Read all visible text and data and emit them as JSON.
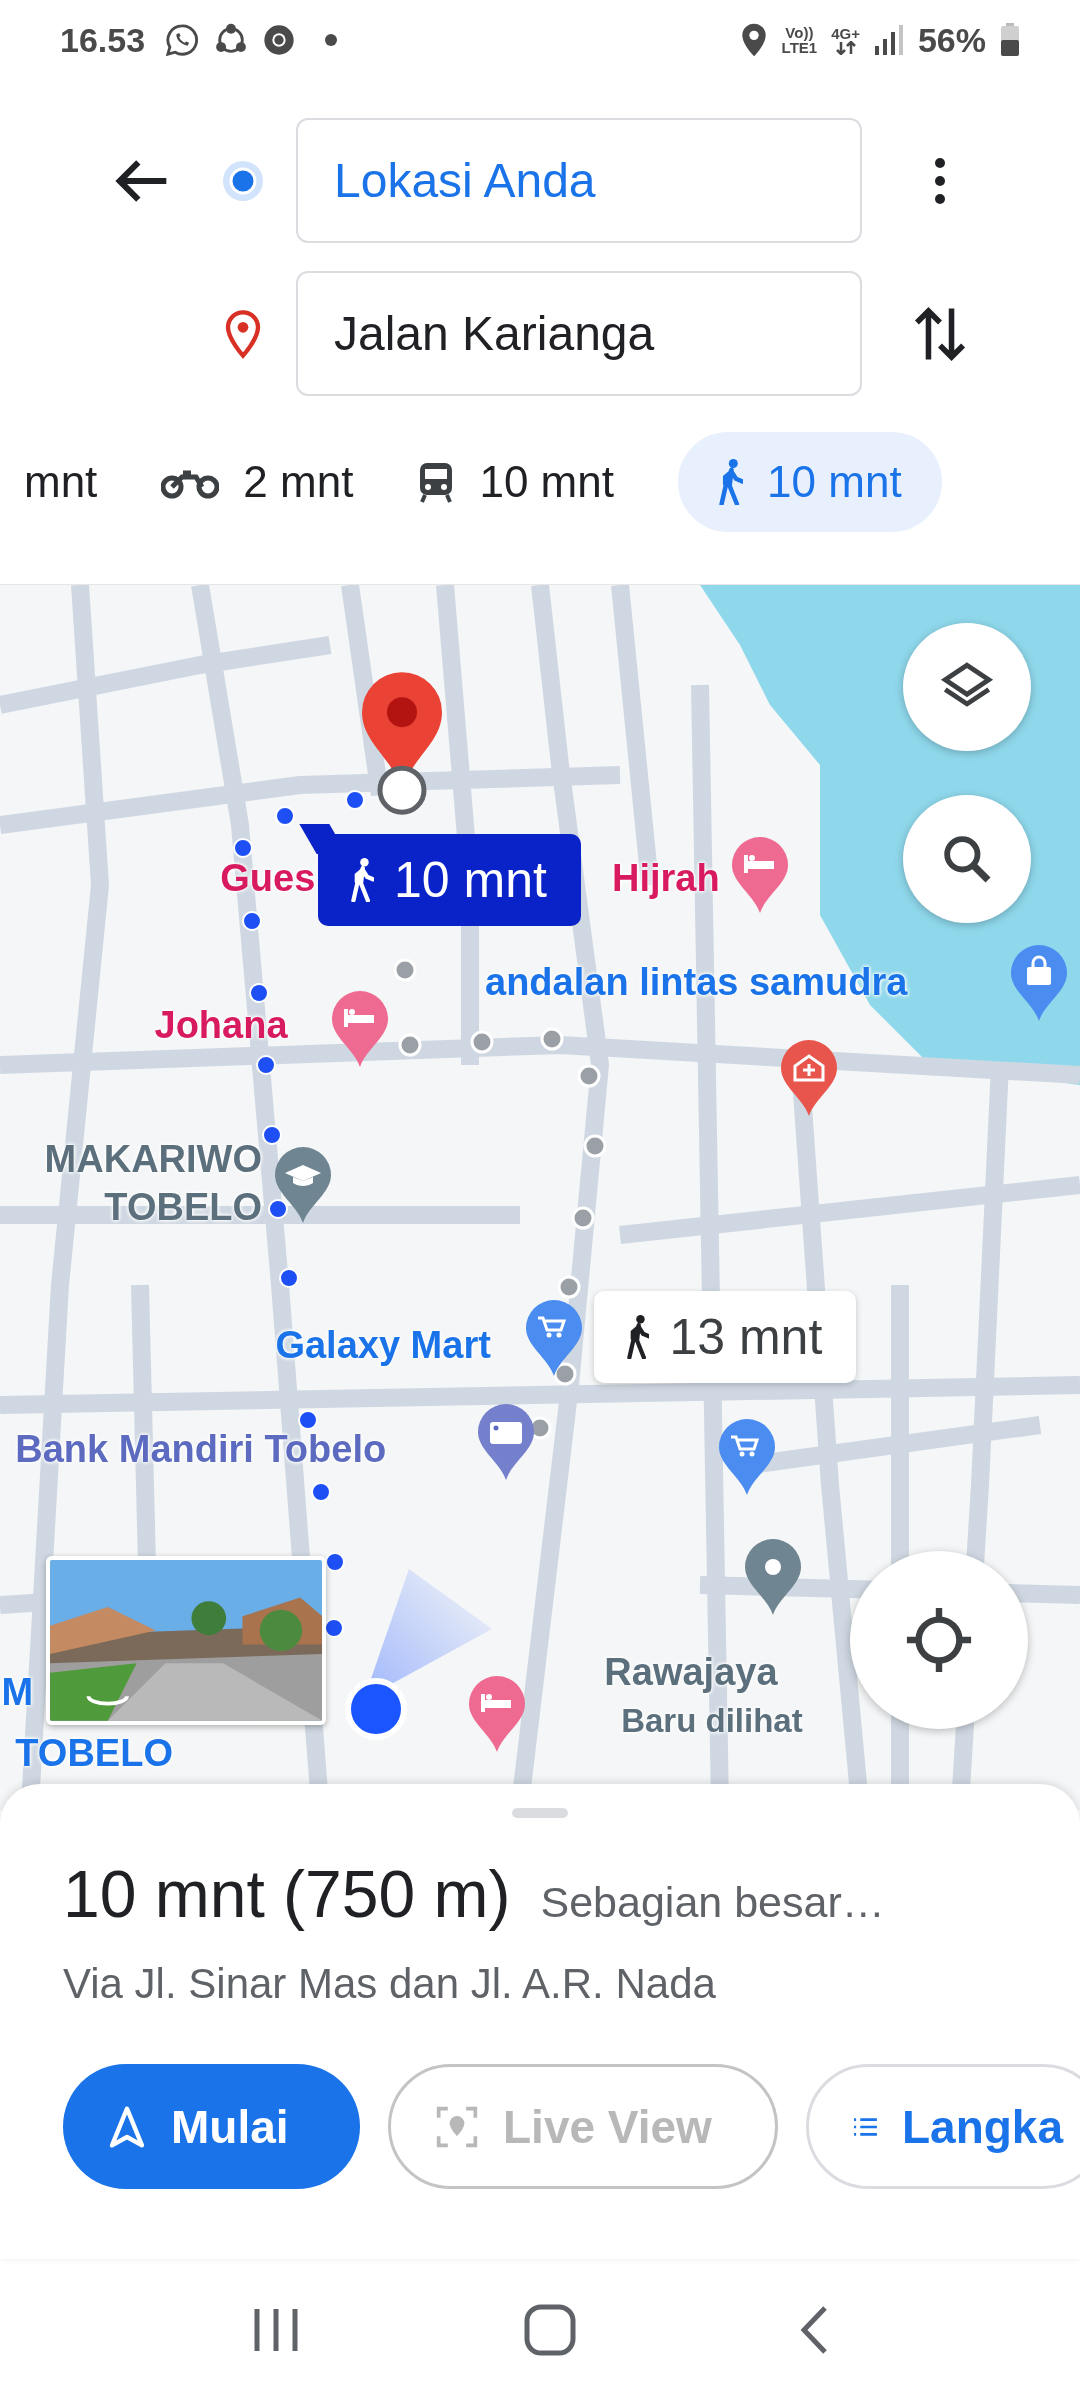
{
  "status_bar": {
    "time": "16.53",
    "volte": "Vo))",
    "lte": "LTE1",
    "network": "4G+",
    "battery": "56%"
  },
  "directions": {
    "origin": {
      "value": "Lokasi Anda"
    },
    "destination": {
      "value": "Jalan Karianga"
    }
  },
  "modes": [
    {
      "label": "mnt",
      "selected": false
    },
    {
      "kind": "motorcycle",
      "label": "2 mnt",
      "selected": false
    },
    {
      "kind": "transit",
      "label": "10 mnt",
      "selected": false
    },
    {
      "kind": "walk",
      "label": "10 mnt",
      "selected": true
    }
  ],
  "map": {
    "labels": [
      {
        "text": "Gues",
        "kind": "lodging"
      },
      {
        "text": "Hijrah",
        "kind": "lodging"
      },
      {
        "text": "andalan lintas samudra",
        "kind": "shop"
      },
      {
        "text": "Johana",
        "kind": "lodging"
      },
      {
        "text": "MAKARIWO TOBELO",
        "kind": "area"
      },
      {
        "text": "Galaxy Mart",
        "kind": "shop"
      },
      {
        "text": "Bank Mandiri Tobelo",
        "kind": "bank"
      },
      {
        "text": "Rawajaya",
        "kind": "area"
      },
      {
        "text": "Baru dilihat",
        "kind": "note"
      },
      {
        "text": "M",
        "kind": "shop"
      },
      {
        "text": "TOBELO",
        "kind": "shop"
      }
    ],
    "route_bubbles": [
      {
        "label": "10 mnt",
        "selected": true
      },
      {
        "label": "13 mnt",
        "selected": false
      }
    ]
  },
  "summary": {
    "title": "10 mnt (750 m)",
    "note": "Sebagian besar…",
    "via": "Via Jl. Sinar Mas dan Jl. A.R. Nada"
  },
  "actions": [
    {
      "kind": "primary",
      "label": "Mulai"
    },
    {
      "kind": "disabled",
      "label": "Live View"
    },
    {
      "kind": "outline",
      "label": "Langka"
    }
  ]
}
